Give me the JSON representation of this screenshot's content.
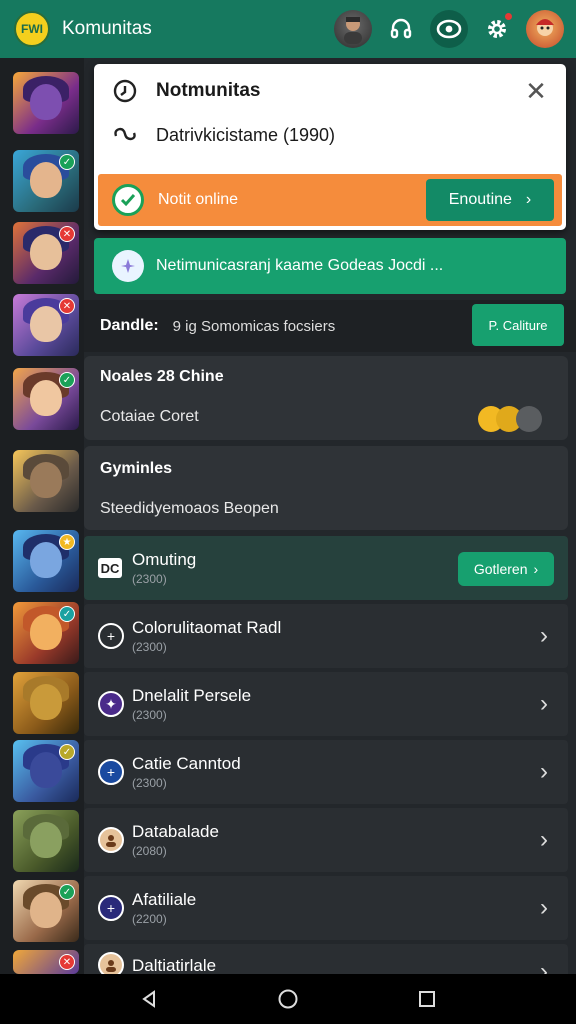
{
  "header": {
    "logo_text": "FWI",
    "title": "Komunitas",
    "icons": [
      "profile-avatar-icon",
      "headset-icon",
      "eye-icon",
      "gear-icon",
      "user-avatar-icon"
    ]
  },
  "popup": {
    "title": "Notmunitas",
    "subtitle": "Datrivkicistame (1990)",
    "status_label": "Notit online",
    "enroll_label": "Enoutine"
  },
  "banner": {
    "text": "Netimunicasranj kaame Godeas Jocdi ..."
  },
  "handle": {
    "key": "Dandle:",
    "value": "9 ig Somomicas focsiers",
    "button_label": "P. Caliture"
  },
  "card1": {
    "heading": "Noales 28 Chine",
    "text": "Cotaiae Coret"
  },
  "card2": {
    "heading": "Gyminles",
    "text": "Steedidyemoaos Beopen"
  },
  "list": [
    {
      "icon": "DC",
      "title": "Omuting",
      "sub": "(2300)",
      "button": "Gotleren"
    },
    {
      "icon": "plus-icon",
      "title": "Colorulitaomat Radl",
      "sub": "(2300)"
    },
    {
      "icon": "star-icon",
      "title": "Dnelalit Persele",
      "sub": "(2300)"
    },
    {
      "icon": "add-icon",
      "title": "Catie Canntod",
      "sub": "(2300)"
    },
    {
      "icon": "person-icon",
      "title": "Databalade",
      "sub": "(2080)"
    },
    {
      "icon": "plus-icon",
      "title": "Afatiliale",
      "sub": "(2200)"
    },
    {
      "icon": "person-icon",
      "title": "Daltiatirlale",
      "sub": ""
    }
  ],
  "rail_badges": [
    "check",
    "check",
    "x",
    "x",
    "check",
    "",
    "check",
    "check",
    "",
    "check",
    "",
    "check",
    "x"
  ],
  "colors": {
    "brand_green": "#16795f",
    "accent_green": "#17a06f",
    "orange": "#f58c3c",
    "background": "#23272b"
  }
}
